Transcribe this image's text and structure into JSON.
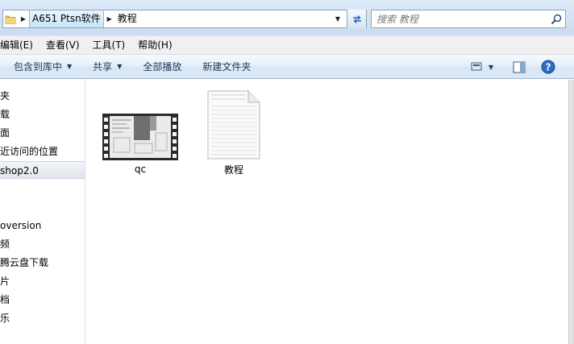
{
  "address": {
    "breadcrumbs": [
      "A651 Ptsn软件",
      "教程"
    ],
    "search_placeholder": "搜索 教程"
  },
  "menu": {
    "items": [
      "编辑(E)",
      "查看(V)",
      "工具(T)",
      "帮助(H)"
    ]
  },
  "toolbar": {
    "include_library": "包含到库中",
    "share": "共享",
    "play_all": "全部播放",
    "new_folder": "新建文件夹"
  },
  "nav": {
    "items": [
      "夹",
      "载",
      "面",
      "近访问的位置",
      "shop2.0",
      "oversion",
      "频",
      "腾云盘下载",
      "片",
      "档",
      "乐"
    ],
    "selected_index": 4
  },
  "files": [
    {
      "name": "qc",
      "icon": "video-file-icon"
    },
    {
      "name": "教程",
      "icon": "text-document-icon"
    }
  ],
  "colors": {
    "accent": "#1e395b",
    "selection": "#c6e4f8"
  }
}
